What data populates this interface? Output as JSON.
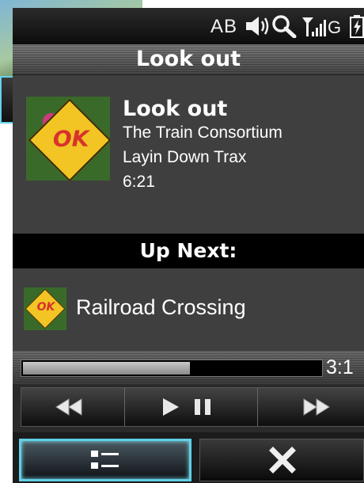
{
  "statusbar": {
    "input_mode": "AB",
    "network_type": "G",
    "icons": [
      "speaker-icon",
      "search-icon",
      "signal-icon",
      "battery-icon"
    ]
  },
  "header": {
    "title": "Look out"
  },
  "now_playing": {
    "title": "Look out",
    "artist": "The Train Consortium",
    "album": "Layin Down Trax",
    "duration": "6:21"
  },
  "up_next": {
    "heading": "Up Next:",
    "title": "Railroad Crossing"
  },
  "progress": {
    "fraction": 0.56,
    "time": "3:1"
  },
  "controls": {
    "icons": [
      "rewind-icon",
      "play-pause-icon",
      "fast-forward-icon"
    ]
  },
  "softkeys": {
    "left_icon": "list-icon",
    "right_icon": "close-icon"
  },
  "colors": {
    "accent": "#5fd0e6",
    "album_art": "#f2c424"
  }
}
